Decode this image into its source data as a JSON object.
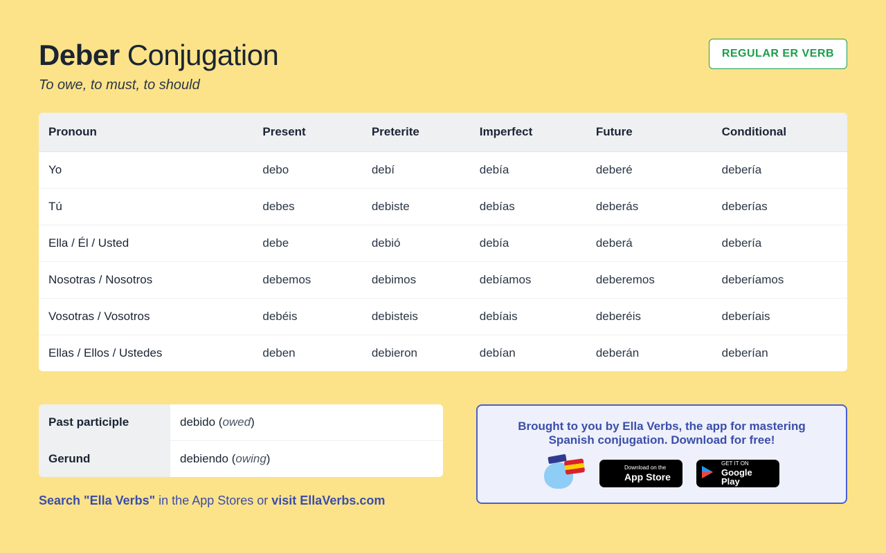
{
  "header": {
    "verb": "Deber",
    "title_suffix": "Conjugation",
    "subtitle": "To owe, to must, to should",
    "badge": "REGULAR ER VERB"
  },
  "table": {
    "headers": [
      "Pronoun",
      "Present",
      "Preterite",
      "Imperfect",
      "Future",
      "Conditional"
    ],
    "rows": [
      [
        "Yo",
        "debo",
        "debí",
        "debía",
        "deberé",
        "debería"
      ],
      [
        "Tú",
        "debes",
        "debiste",
        "debías",
        "deberás",
        "deberías"
      ],
      [
        "Ella / Él / Usted",
        "debe",
        "debió",
        "debía",
        "deberá",
        "debería"
      ],
      [
        "Nosotras / Nosotros",
        "debemos",
        "debimos",
        "debíamos",
        "deberemos",
        "deberíamos"
      ],
      [
        "Vosotras / Vosotros",
        "debéis",
        "debisteis",
        "debíais",
        "deberéis",
        "deberíais"
      ],
      [
        "Ellas / Ellos / Ustedes",
        "deben",
        "debieron",
        "debían",
        "deberán",
        "deberían"
      ]
    ]
  },
  "participles": {
    "past_label": "Past participle",
    "past_value": "debido",
    "past_trans": "owed",
    "gerund_label": "Gerund",
    "gerund_value": "debiendo",
    "gerund_trans": "owing"
  },
  "search_line": {
    "part1": "Search \"Ella Verbs\"",
    "part2": " in the App Stores or ",
    "part3": "visit EllaVerbs.com"
  },
  "promo": {
    "line1": "Brought to you by Ella Verbs, the app for mastering",
    "line2": "Spanish conjugation. Download for free!",
    "appstore_small": "Download on the",
    "appstore_big": "App Store",
    "play_small": "GET IT ON",
    "play_big": "Google Play"
  }
}
